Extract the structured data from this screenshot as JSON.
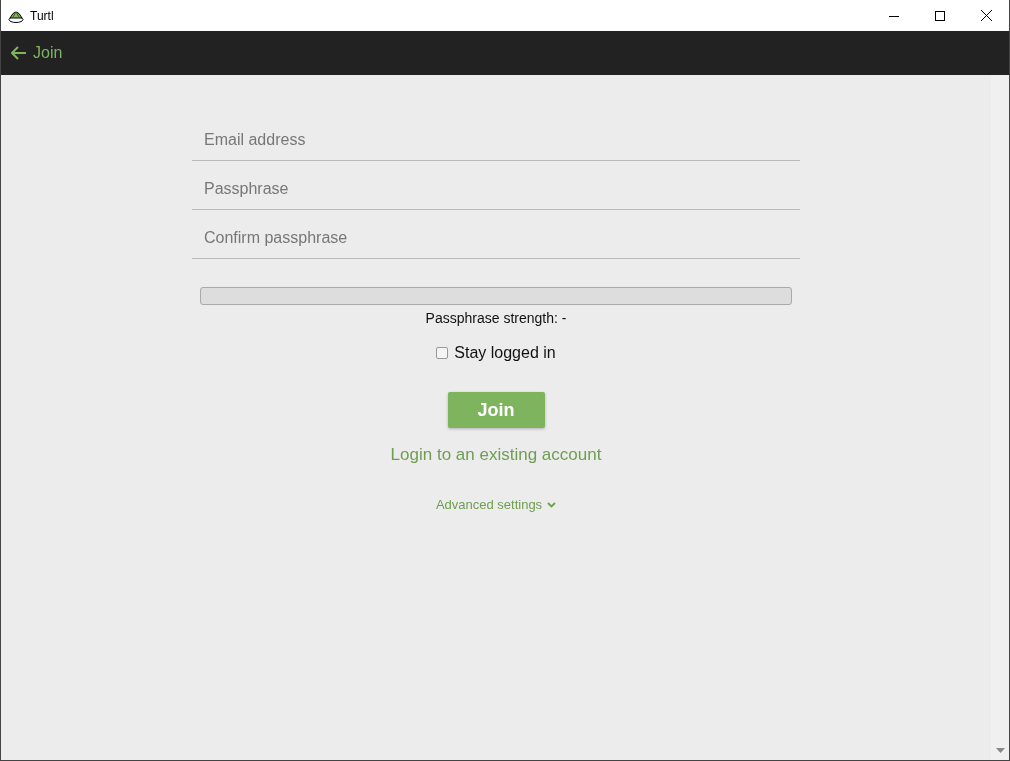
{
  "window": {
    "title": "Turtl"
  },
  "header": {
    "title": "Join"
  },
  "fields": [
    {
      "placeholder": "Email address"
    },
    {
      "placeholder": "Passphrase"
    },
    {
      "placeholder": "Confirm passphrase"
    }
  ],
  "strength": {
    "level": 0,
    "text": "Passphrase strength: -"
  },
  "stay_logged_in": {
    "label": "Stay logged in",
    "checked": false
  },
  "join_button": "Join",
  "login_link": "Login to an existing account",
  "advanced": {
    "label": "Advanced settings",
    "expanded": false
  }
}
